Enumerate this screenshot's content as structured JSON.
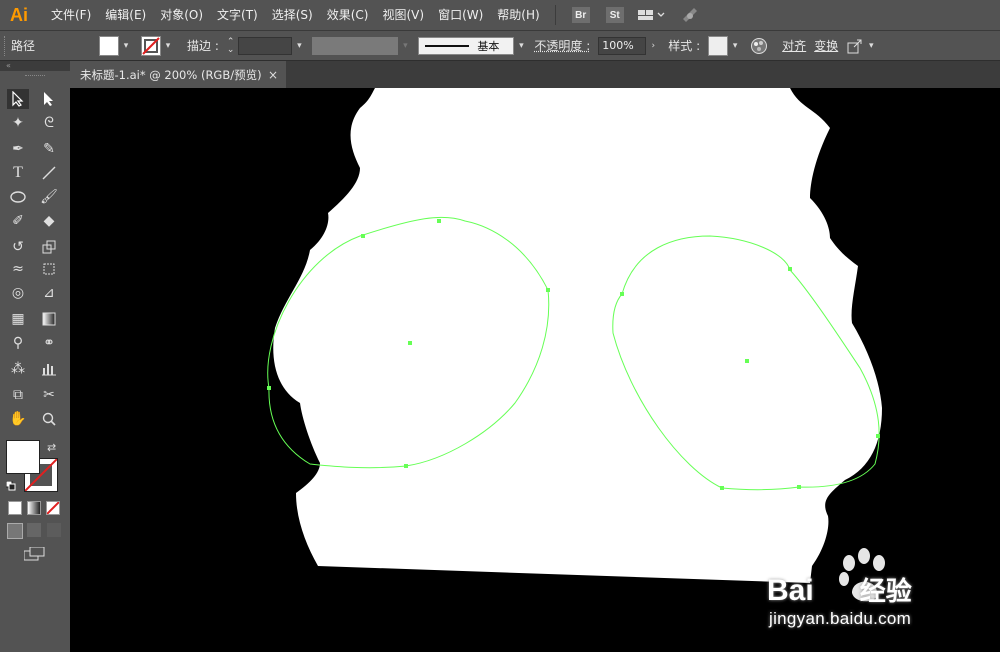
{
  "app": {
    "logo": "Ai"
  },
  "menu": [
    "文件(F)",
    "编辑(E)",
    "对象(O)",
    "文字(T)",
    "选择(S)",
    "效果(C)",
    "视图(V)",
    "窗口(W)",
    "帮助(H)"
  ],
  "bridge_label": "Br",
  "stock_label": "St",
  "control": {
    "selection_type": "路径",
    "stroke_label": "描边",
    "stroke_profile": "基本",
    "opacity_label": "不透明度",
    "opacity_value": "100%",
    "style_label": "样式",
    "align_label": "对齐",
    "transform_label": "变换"
  },
  "document_tab": {
    "title": "未标题-1.ai* @ 200% (RGB/预览)",
    "close": "×"
  },
  "watermark": {
    "brand": "Bai",
    "brand2": "经验",
    "url": "jingyan.baidu.com"
  },
  "colors": {
    "ui_bg": "#535353",
    "path_color": "#66ff55",
    "logo": "#ff9a00"
  }
}
